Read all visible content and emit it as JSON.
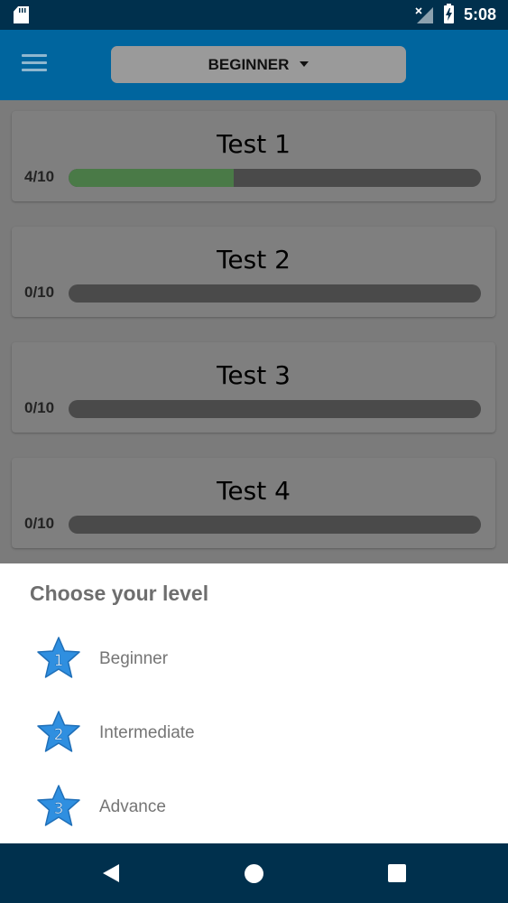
{
  "status_bar": {
    "time": "5:08",
    "icons": [
      "sd-card-icon",
      "signal-off-icon",
      "battery-charging-icon"
    ]
  },
  "app_bar": {
    "menu_icon": "hamburger-menu-icon",
    "level_selector": "BEGINNER",
    "caret_icon": "caret-down-icon"
  },
  "tests": [
    {
      "title": "Test 1",
      "score": "4/10",
      "progress": 0.4
    },
    {
      "title": "Test 2",
      "score": "0/10",
      "progress": 0
    },
    {
      "title": "Test 3",
      "score": "0/10",
      "progress": 0
    },
    {
      "title": "Test 4",
      "score": "0/10",
      "progress": 0
    }
  ],
  "bottom_sheet": {
    "title": "Choose your level",
    "options": [
      {
        "label": "Beginner",
        "badge": "1",
        "icon": "star-1-icon"
      },
      {
        "label": "Intermediate",
        "badge": "2",
        "icon": "star-2-icon"
      },
      {
        "label": "Advance",
        "badge": "3",
        "icon": "star-3-icon"
      }
    ]
  },
  "nav_bar": {
    "icons": [
      "back-icon",
      "home-icon",
      "recents-icon"
    ]
  },
  "colors": {
    "status_bar": "#00304d",
    "app_bar": "#00659e",
    "progress_fill": "#4a7a47",
    "star_blue": "#2f8fe0"
  }
}
